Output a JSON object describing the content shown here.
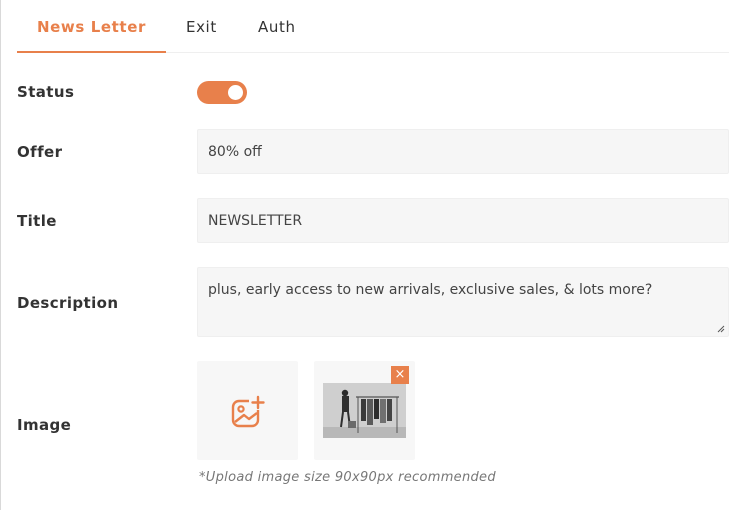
{
  "tabs": [
    {
      "label": "News Letter",
      "active": true
    },
    {
      "label": "Exit",
      "active": false
    },
    {
      "label": "Auth",
      "active": false
    }
  ],
  "form": {
    "status": {
      "label": "Status",
      "enabled": true
    },
    "offer": {
      "label": "Offer",
      "value": "80% off"
    },
    "title": {
      "label": "Title",
      "value": "NEWSLETTER"
    },
    "description": {
      "label": "Description",
      "value": "plus, early access to new arrivals, exclusive sales, & lots more?"
    },
    "image": {
      "label": "Image",
      "upload_icon": "add-image-icon",
      "remove_icon": "close-icon",
      "remove_symbol": "×",
      "hint": "*Upload image size 90x90px recommended"
    }
  },
  "colors": {
    "accent": "#e8804b",
    "field_bg": "#f6f6f6"
  }
}
